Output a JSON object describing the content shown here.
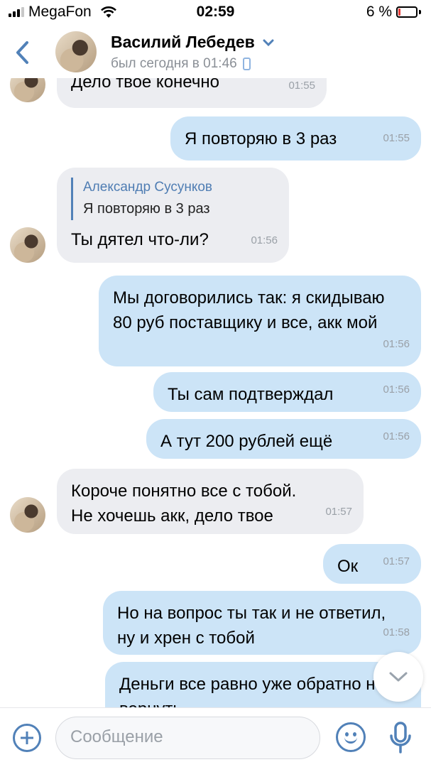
{
  "status_bar": {
    "carrier": "MegaFon",
    "time": "02:59",
    "battery": "6 %"
  },
  "header": {
    "contact_name": "Василий Лебедев",
    "last_seen": "был сегодня в 01:46"
  },
  "messages": [
    {
      "dir": "in",
      "text": "Дело твое конечно",
      "time": "01:55"
    },
    {
      "dir": "out",
      "text": "Я повторяю в 3 раз",
      "time": "01:55"
    },
    {
      "dir": "in",
      "reply_name": "Александр Сусунков",
      "reply_text": "Я повторяю в 3 раз",
      "text": "Ты дятел что-ли?",
      "time": "01:56"
    },
    {
      "dir": "out",
      "text": "Мы договорились так: я скидываю 80 руб поставщику и все, акк мой",
      "time": "01:56"
    },
    {
      "dir": "out",
      "text": "Ты сам подтверждал",
      "time": "01:56"
    },
    {
      "dir": "out",
      "text": "А тут 200 рублей ещё",
      "time": "01:56"
    },
    {
      "dir": "in",
      "text": "Короче понятно все с тобой. Не хочешь акк, дело твое",
      "time": "01:57"
    },
    {
      "dir": "out",
      "text": "Ок",
      "time": "01:57"
    },
    {
      "dir": "out",
      "text": "Но на вопрос ты так и не ответил, ну и хрен с тобой",
      "time": "01:58"
    },
    {
      "dir": "out",
      "text": "Деньги все равно уже обратно не вернуть",
      "time": ""
    }
  ],
  "composer": {
    "placeholder": "Сообщение"
  },
  "colors": {
    "accent": "#5181b8",
    "incoming_bubble": "#ecedf1",
    "outgoing_bubble": "#cce4f7"
  },
  "icons": [
    "back-chevron-icon",
    "dropdown-chevron-icon",
    "phone-icon",
    "scroll-down-icon",
    "attach-plus-icon",
    "emoji-icon",
    "microphone-icon"
  ]
}
